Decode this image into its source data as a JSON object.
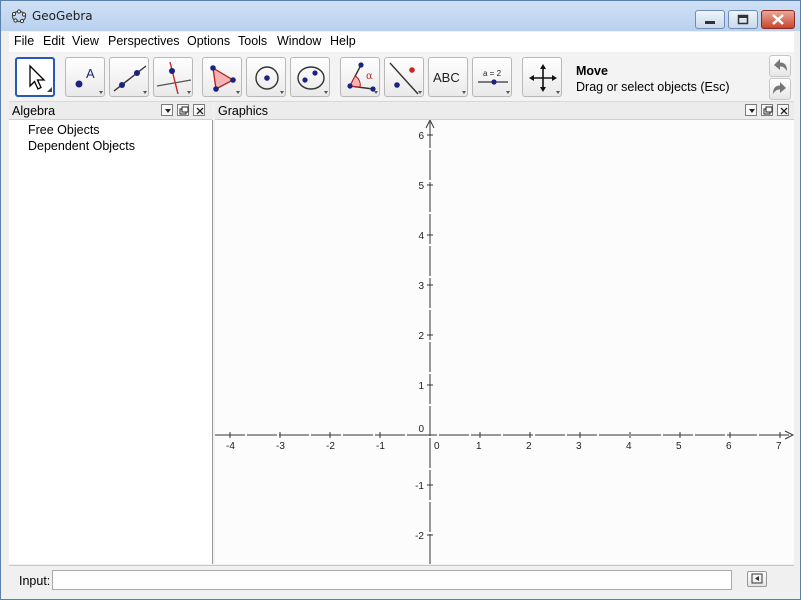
{
  "window": {
    "title": "GeoGebra"
  },
  "menubar": {
    "items": [
      "File",
      "Edit",
      "View",
      "Perspectives",
      "Options",
      "Tools",
      "Window",
      "Help"
    ]
  },
  "toolbar": {
    "tools": [
      {
        "name": "move",
        "icon": "move-arrow-icon"
      },
      {
        "name": "new-point",
        "icon": "point-icon"
      },
      {
        "name": "line-through-two-points",
        "icon": "line-icon"
      },
      {
        "name": "perpendicular-line",
        "icon": "perpendicular-line-icon"
      },
      {
        "name": "polygon",
        "icon": "polygon-icon"
      },
      {
        "name": "circle-center-point",
        "icon": "circle-icon"
      },
      {
        "name": "ellipse",
        "icon": "ellipse-icon"
      },
      {
        "name": "angle",
        "icon": "angle-icon"
      },
      {
        "name": "reflect-about-line",
        "icon": "reflect-icon"
      },
      {
        "name": "text",
        "icon": "text-icon",
        "label": "ABC"
      },
      {
        "name": "slider",
        "icon": "slider-icon",
        "label": "a = 2"
      },
      {
        "name": "move-graphics-view",
        "icon": "move-view-icon"
      }
    ],
    "active_tool_name": "Move",
    "active_tool_help": "Drag or select objects (Esc)"
  },
  "algebra": {
    "title": "Algebra",
    "items": [
      "Free Objects",
      "Dependent Objects"
    ]
  },
  "graphics": {
    "title": "Graphics",
    "x_ticks": [
      "-4",
      "-3",
      "-2",
      "-1",
      "0",
      "1",
      "2",
      "3",
      "4",
      "5",
      "6",
      "7"
    ],
    "y_ticks": [
      "6",
      "5",
      "4",
      "3",
      "2",
      "1",
      "0",
      "-1",
      "-2"
    ]
  },
  "inputbar": {
    "label": "Input:",
    "value": "",
    "placeholder": ""
  },
  "colors": {
    "selected_tool_border": "#2b55b6",
    "point_blue": "#1a237e",
    "accent_red": "#c62828"
  }
}
